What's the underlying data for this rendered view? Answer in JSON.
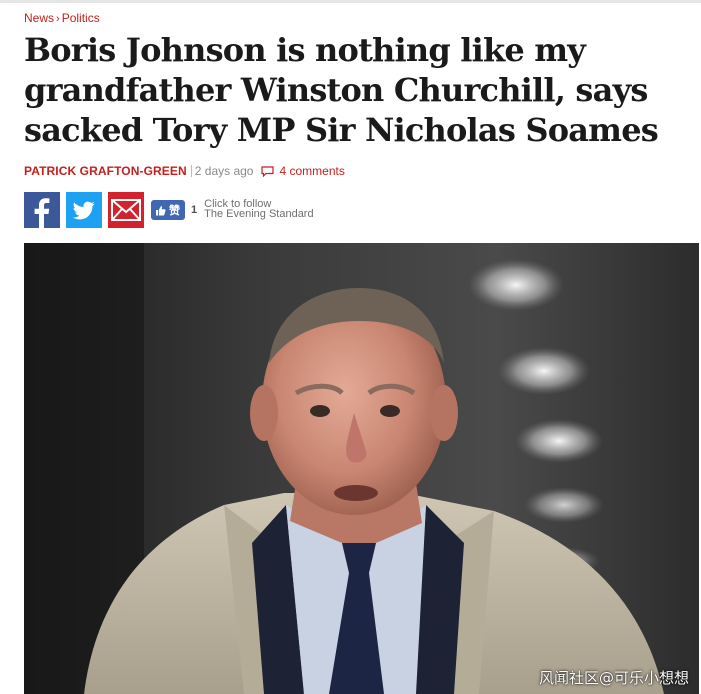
{
  "breadcrumb": {
    "section": "News",
    "separator": "›",
    "subsection": "Politics"
  },
  "article": {
    "headline_lines": [
      "Boris Johnson is nothing like my",
      "grandfather Winston Churchill, says",
      "sacked Tory MP Sir Nicholas Soames"
    ],
    "author": "PATRICK GRAFTON-GREEN",
    "published": "2 days ago",
    "comments": "4 comments"
  },
  "share": {
    "facebook_icon": "facebook-icon",
    "twitter_icon": "twitter-icon",
    "email_icon": "mail-icon",
    "like_label": "赞",
    "like_count": "1",
    "follow_line1": "Click to follow",
    "follow_line2": "The Evening Standard"
  },
  "photo": {
    "subject": "portrait-photo",
    "watermark": "风闻社区@可乐小想想"
  },
  "colors": {
    "accent": "#c4201d",
    "facebook": "#3b5998",
    "twitter": "#1da1f2",
    "email": "#d2222d",
    "like": "#4267b2"
  }
}
